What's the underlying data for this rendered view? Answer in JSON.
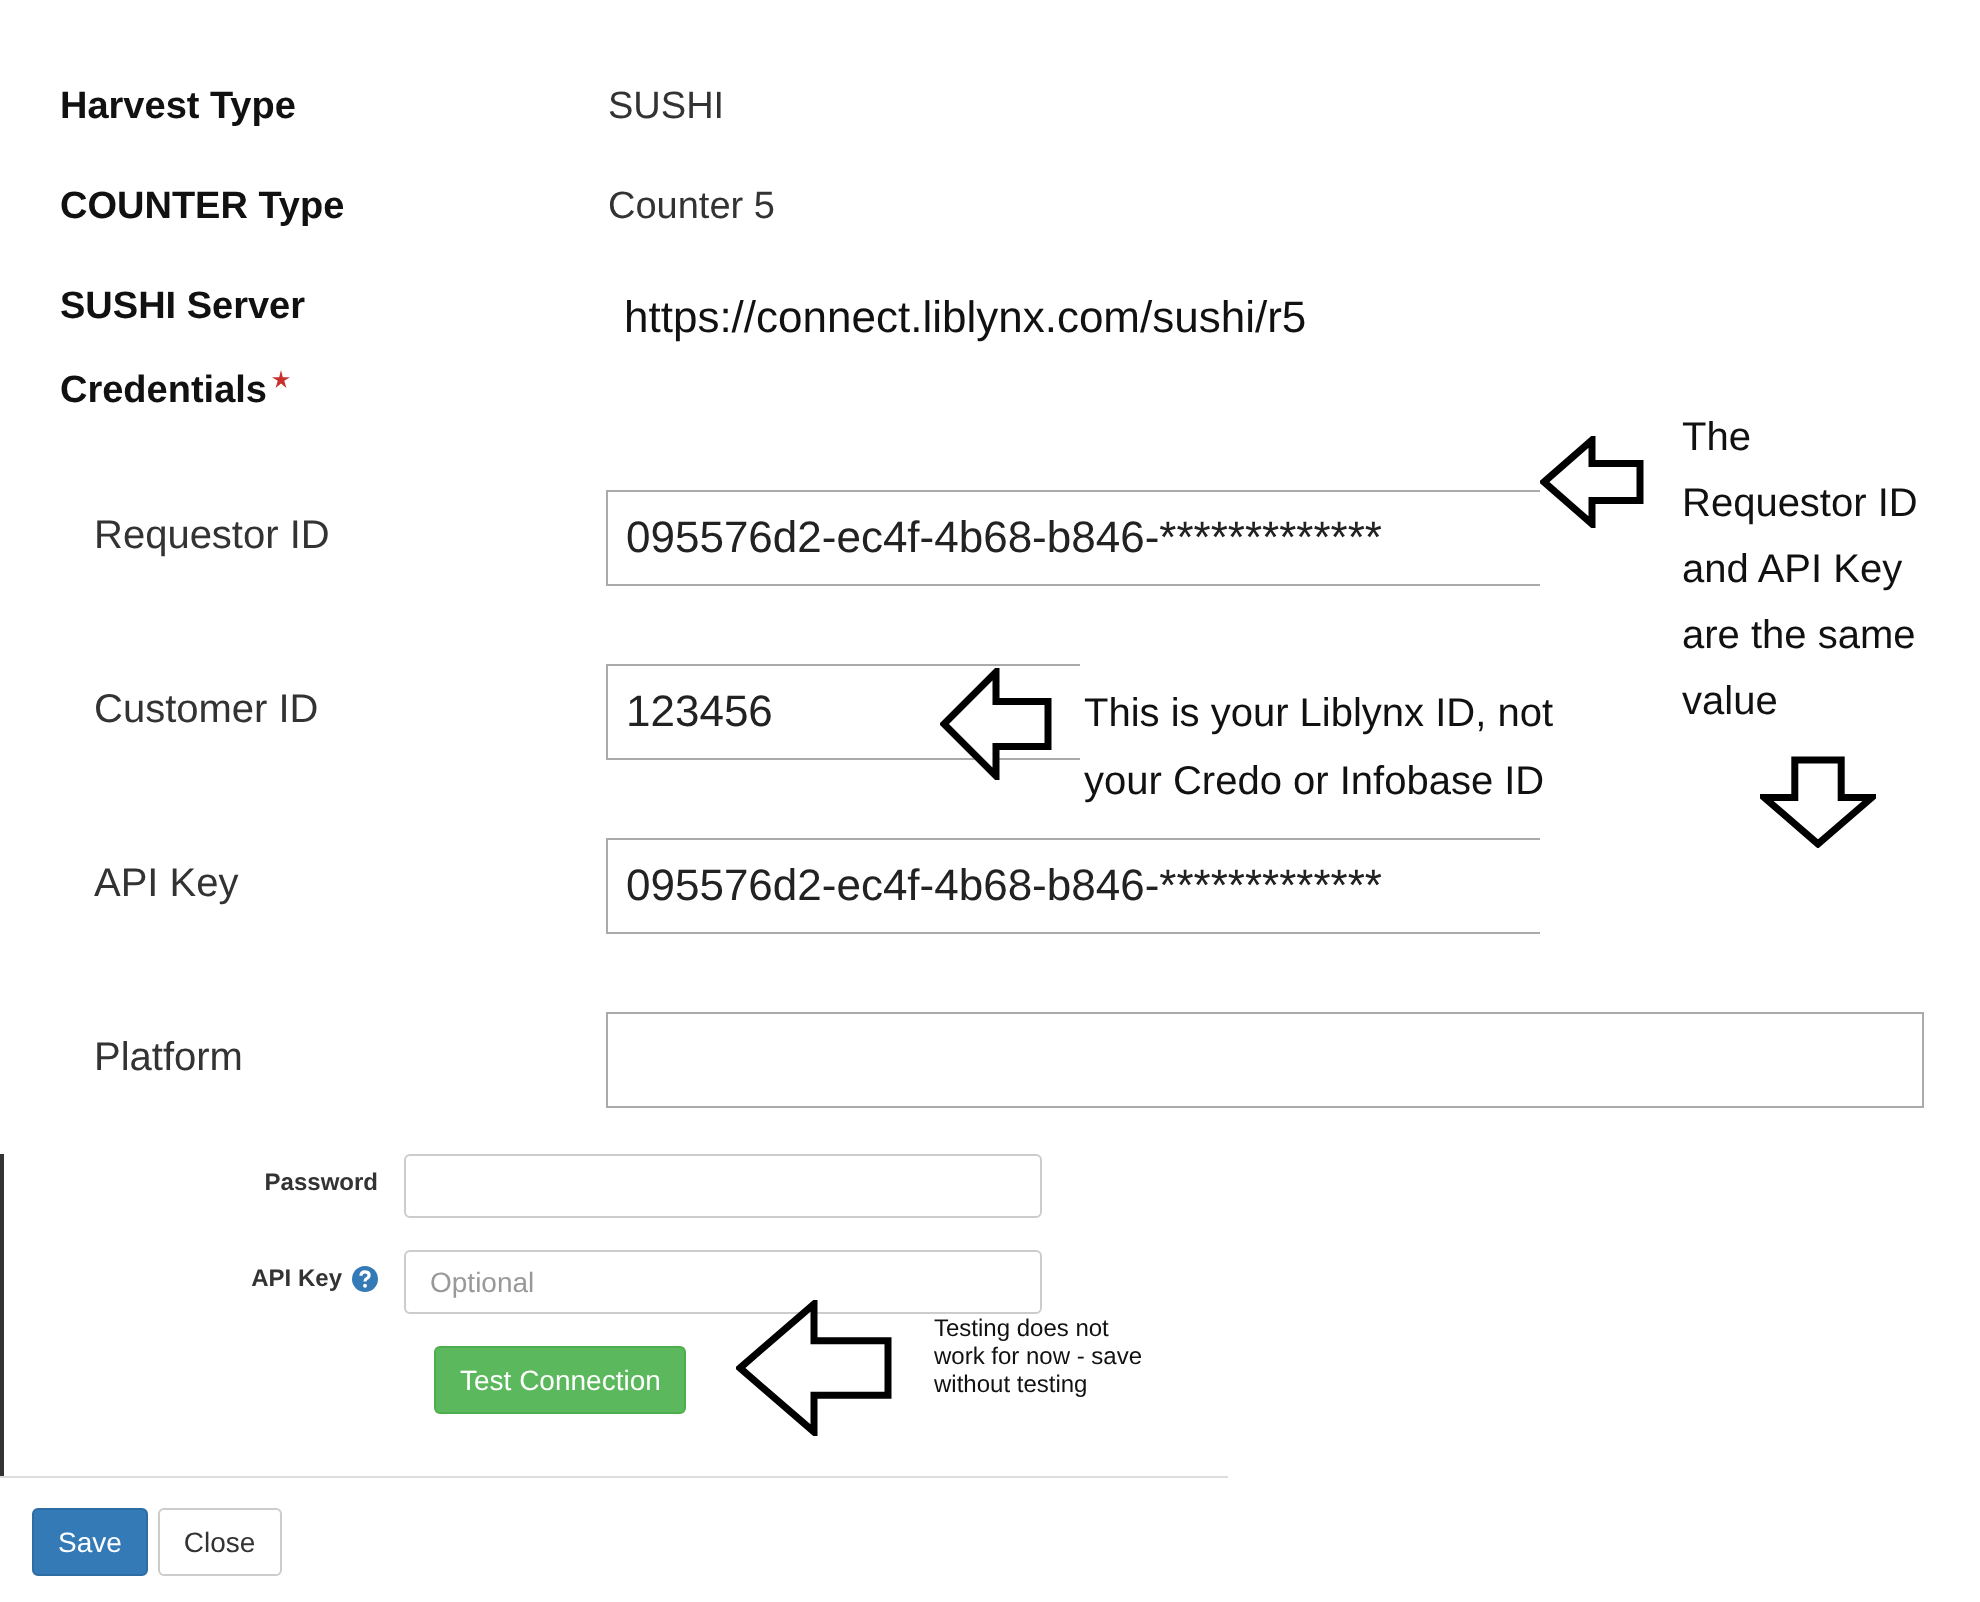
{
  "summary": [
    {
      "label": "Harvest Type",
      "value": "SUSHI",
      "kind": "plain"
    },
    {
      "label": "COUNTER Type",
      "value": "Counter 5",
      "kind": "plain"
    },
    {
      "label": "SUSHI Server",
      "value": "https://connect.liblynx.com/sushi/r5",
      "kind": "pasted"
    }
  ],
  "credentials": {
    "label": "Credentials",
    "required": true,
    "fields": [
      {
        "label": "Requestor ID",
        "value": "095576d2-ec4f-4b68-b846-*************"
      },
      {
        "label": "Customer ID",
        "value": "123456"
      },
      {
        "label": "API Key",
        "value": "095576d2-ec4f-4b68-b846-*************"
      },
      {
        "label": "Platform"
      }
    ]
  },
  "auth_form": {
    "fields": [
      {
        "label": "Password"
      },
      {
        "label": "API Key",
        "placeholder": "Optional",
        "help": true
      }
    ],
    "test_button": "Test Connection"
  },
  "footer_buttons": [
    {
      "label": "Save",
      "kind": "primary"
    },
    {
      "label": "Close",
      "kind": "default"
    }
  ],
  "annotations": [
    {
      "text": "The Requestor ID and API Key are the same value"
    },
    {
      "text": "This is your Liblynx ID, not your Credo or Infobase ID"
    },
    {
      "text": "Testing does not work for now - save without testing"
    }
  ]
}
